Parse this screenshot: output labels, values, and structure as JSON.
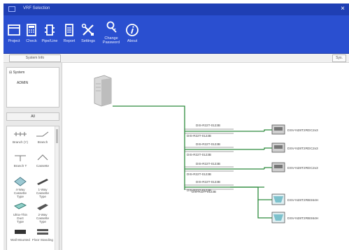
{
  "window": {
    "title": "VRF Selection"
  },
  "ribbon": {
    "buttons": [
      {
        "label": "Project",
        "icon": "project-icon"
      },
      {
        "label": "Check",
        "icon": "calculator-icon"
      },
      {
        "label": "Pipe/Line",
        "icon": "pipe-icon"
      },
      {
        "label": "Report",
        "icon": "report-icon"
      },
      {
        "label": "Settings",
        "icon": "tools-icon"
      },
      {
        "label": "Change\nPassword",
        "icon": "key-icon"
      },
      {
        "label": "About",
        "icon": "info-icon"
      }
    ]
  },
  "subbar": {
    "tab_label": "System Info",
    "right_button": "Sys."
  },
  "tree": {
    "root": "System",
    "child": "ADMIN"
  },
  "left": {
    "mid_button": "All"
  },
  "palette": {
    "items": [
      {
        "label": "Branch (Y)",
        "icon": "branch-y-icon"
      },
      {
        "label": "Branch",
        "icon": "branch-icon"
      },
      {
        "label": "Branch T",
        "icon": "branch-t-icon"
      },
      {
        "label": "Cassette",
        "icon": "cassette-icon"
      },
      {
        "label": "4-Way Cassette\nType",
        "icon": "cassette-4way-icon"
      },
      {
        "label": "1-Way Cassette\nType",
        "icon": "cassette-1way-icon"
      },
      {
        "label": "Ultra-Thin Duct\nType",
        "icon": "duct-icon"
      },
      {
        "label": "2-Way Cassette\nType",
        "icon": "cassette-2way-icon"
      },
      {
        "label": "Wall Mounted",
        "icon": "wall-icon"
      },
      {
        "label": "Floor Standing",
        "icon": "floor-icon"
      }
    ]
  },
  "diagram": {
    "branch_labels": [
      "DIS-R22T-0123B",
      "DIS-R22T-0123B",
      "DIS-R22T-0123B",
      "DIS-R22T-0123B",
      "DIS-R22T-0123B",
      "DIS-R22T-0123B",
      "DIS-R22T-0123B",
      "DIS-R22T-0123B",
      "DIS-R22T-0123B"
    ],
    "units": [
      {
        "label": "DSV-N28T2RDC2x3"
      },
      {
        "label": "DSV-N28T2RDC2x3"
      },
      {
        "label": "DSV-N28T2RDC2x3"
      },
      {
        "label": "DSV-N28T2RBS64H"
      },
      {
        "label": "DSV-N28T2RBS64H"
      }
    ]
  },
  "colors": {
    "pipe": "#2e8b3d",
    "ribbon": "#2a4fd0",
    "titlebar": "#1f3fb4"
  }
}
